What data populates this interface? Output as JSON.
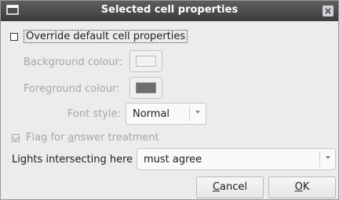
{
  "dialog": {
    "title": "Selected cell properties",
    "close_glyph": "×"
  },
  "override": {
    "label": "Override default cell properties",
    "checked": false
  },
  "background": {
    "label": "Background colour:",
    "swatch_color": "#f2f2f2"
  },
  "foreground": {
    "label": "Foreground colour:",
    "swatch_color": "#6e6e6e"
  },
  "font_style": {
    "label": "Font style:",
    "value": "Normal"
  },
  "flag": {
    "label_prefix": "Flag for ",
    "label_mnemonic": "a",
    "label_suffix": "nswer treatment",
    "checked": true
  },
  "lights": {
    "label": "Lights intersecting here",
    "value": "must agree"
  },
  "buttons": {
    "cancel_mnemonic": "C",
    "cancel_rest": "ancel",
    "ok_mnemonic": "O",
    "ok_rest": "K"
  }
}
